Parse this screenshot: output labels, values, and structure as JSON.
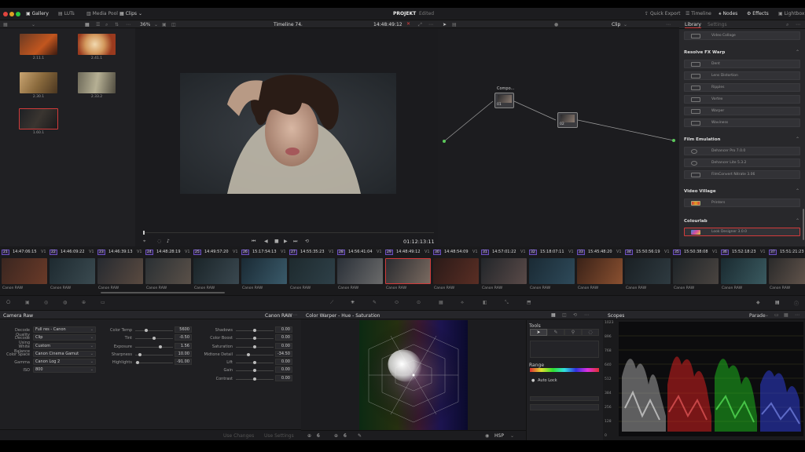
{
  "topbar": {
    "gallery": "Gallery",
    "luts": "LUTs",
    "media_pool": "Media Pool",
    "clips": "Clips",
    "project": "PROJEKT",
    "edited": "Edited",
    "quick_export": "Quick Export",
    "timeline": "Timeline",
    "nodes": "Nodes",
    "effects": "Effects",
    "lightbox": "Lightbox"
  },
  "viewer": {
    "zoom": "36%",
    "timeline_name": "Timeline 74",
    "timecode": "14:48:49:12",
    "playhead_tc": "01:12:13:11"
  },
  "nodes": {
    "clip_label": "Clip",
    "node1_label": "Compo...",
    "node1_num": "01",
    "node2_num": "02"
  },
  "gallery": {
    "stills": [
      {
        "label": "2.11.1"
      },
      {
        "label": "2.41.1"
      },
      {
        "label": "2.30.1"
      },
      {
        "label": "2.33.2"
      },
      {
        "label": "1.60.1"
      }
    ]
  },
  "library": {
    "tab_library": "Library",
    "tab_settings": "Settings",
    "top_item": "Video Collage",
    "sections": [
      {
        "title": "Resolve FX Warp",
        "items": [
          "Dent",
          "Lens Distortion",
          "Ripples",
          "Vortex",
          "Warper",
          "Waviness"
        ]
      },
      {
        "title": "Film Emulation",
        "items": [
          "Dehancer Pro 7.0.0",
          "Dehancer Lite 5.3.2",
          "FilmConvert Nitrate 3.06"
        ]
      },
      {
        "title": "Video Village",
        "items": [
          "Printers"
        ]
      },
      {
        "title": "Colourlab",
        "items": [
          "Look Designer 3.0.0"
        ]
      }
    ]
  },
  "timeline": {
    "clips": [
      {
        "num": "21",
        "tc": "14:47:06:15",
        "label": "Canon RAW"
      },
      {
        "num": "22",
        "tc": "14:46:09:22",
        "label": "Canon RAW"
      },
      {
        "num": "23",
        "tc": "14:46:39:13",
        "label": "Canon RAW"
      },
      {
        "num": "24",
        "tc": "14:48:28:19",
        "label": "Canon RAW"
      },
      {
        "num": "25",
        "tc": "14:49:57:20",
        "label": "Canon RAW"
      },
      {
        "num": "26",
        "tc": "15:17:54:13",
        "label": "Canon RAW"
      },
      {
        "num": "27",
        "tc": "14:55:35:23",
        "label": "Canon RAW"
      },
      {
        "num": "28",
        "tc": "14:56:41:04",
        "label": "Canon RAW"
      },
      {
        "num": "29",
        "tc": "14:48:49:12",
        "label": "Canon RAW"
      },
      {
        "num": "30",
        "tc": "14:48:54:09",
        "label": "Canon RAW"
      },
      {
        "num": "31",
        "tc": "14:57:01:22",
        "label": "Canon RAW"
      },
      {
        "num": "32",
        "tc": "15:18:07:11",
        "label": "Canon RAW"
      },
      {
        "num": "33",
        "tc": "15:45:48:20",
        "label": "Canon RAW"
      },
      {
        "num": "34",
        "tc": "15:50:56:19",
        "label": "Canon RAW"
      },
      {
        "num": "35",
        "tc": "15:50:38:08",
        "label": "Canon RAW"
      },
      {
        "num": "36",
        "tc": "15:52:18:23",
        "label": "Canon RAW"
      },
      {
        "num": "37",
        "tc": "15:51:21:23",
        "label": "Canon RAW"
      }
    ],
    "track": "V1"
  },
  "camera_raw": {
    "title": "Camera Raw",
    "source": "Canon RAW",
    "decode_quality_label": "Decode Quality",
    "decode_quality": "Full res - Canon",
    "decode_using_label": "Decode Using",
    "decode_using": "Clip",
    "white_balance_label": "White Balance",
    "white_balance": "Custom",
    "color_space_label": "Color Space",
    "color_space": "Canon Cinema Gamut",
    "gamma_label": "Gamma",
    "gamma": "Canon Log 2",
    "iso_label": "ISO",
    "iso": "800",
    "color_temp_label": "Color Temp",
    "color_temp": "5600",
    "tint_label": "Tint",
    "tint": "-0.50",
    "exposure_label": "Exposure",
    "exposure": "1.56",
    "sharpness_label": "Sharpness",
    "sharpness": "10.00",
    "highlights_label": "Highlights",
    "highlights": "-91.00",
    "shadows_label": "Shadows",
    "shadows": "0.00",
    "color_boost_label": "Color Boost",
    "color_boost": "0.00",
    "saturation_label": "Saturation",
    "saturation": "0.00",
    "midtone_detail_label": "Midtone Detail",
    "midtone_detail": "-34.50",
    "lift_label": "Lift",
    "lift": "0.00",
    "gain_label": "Gain",
    "gain": "0.00",
    "contrast_label": "Contrast",
    "contrast": "0.00",
    "use_changes": "Use Changes",
    "use_settings": "Use Settings"
  },
  "warper": {
    "title": "Color Warper - Hue - Saturation",
    "tools_label": "Tools",
    "range_label": "Range",
    "auto_lock": "Auto Lock",
    "hue_count": "6",
    "sat_count": "6",
    "mode": "HSP"
  },
  "scopes": {
    "title": "Scopes",
    "mode": "Parade",
    "ticks": [
      "1023",
      "896",
      "768",
      "640",
      "512",
      "384",
      "256",
      "128",
      "0"
    ]
  }
}
